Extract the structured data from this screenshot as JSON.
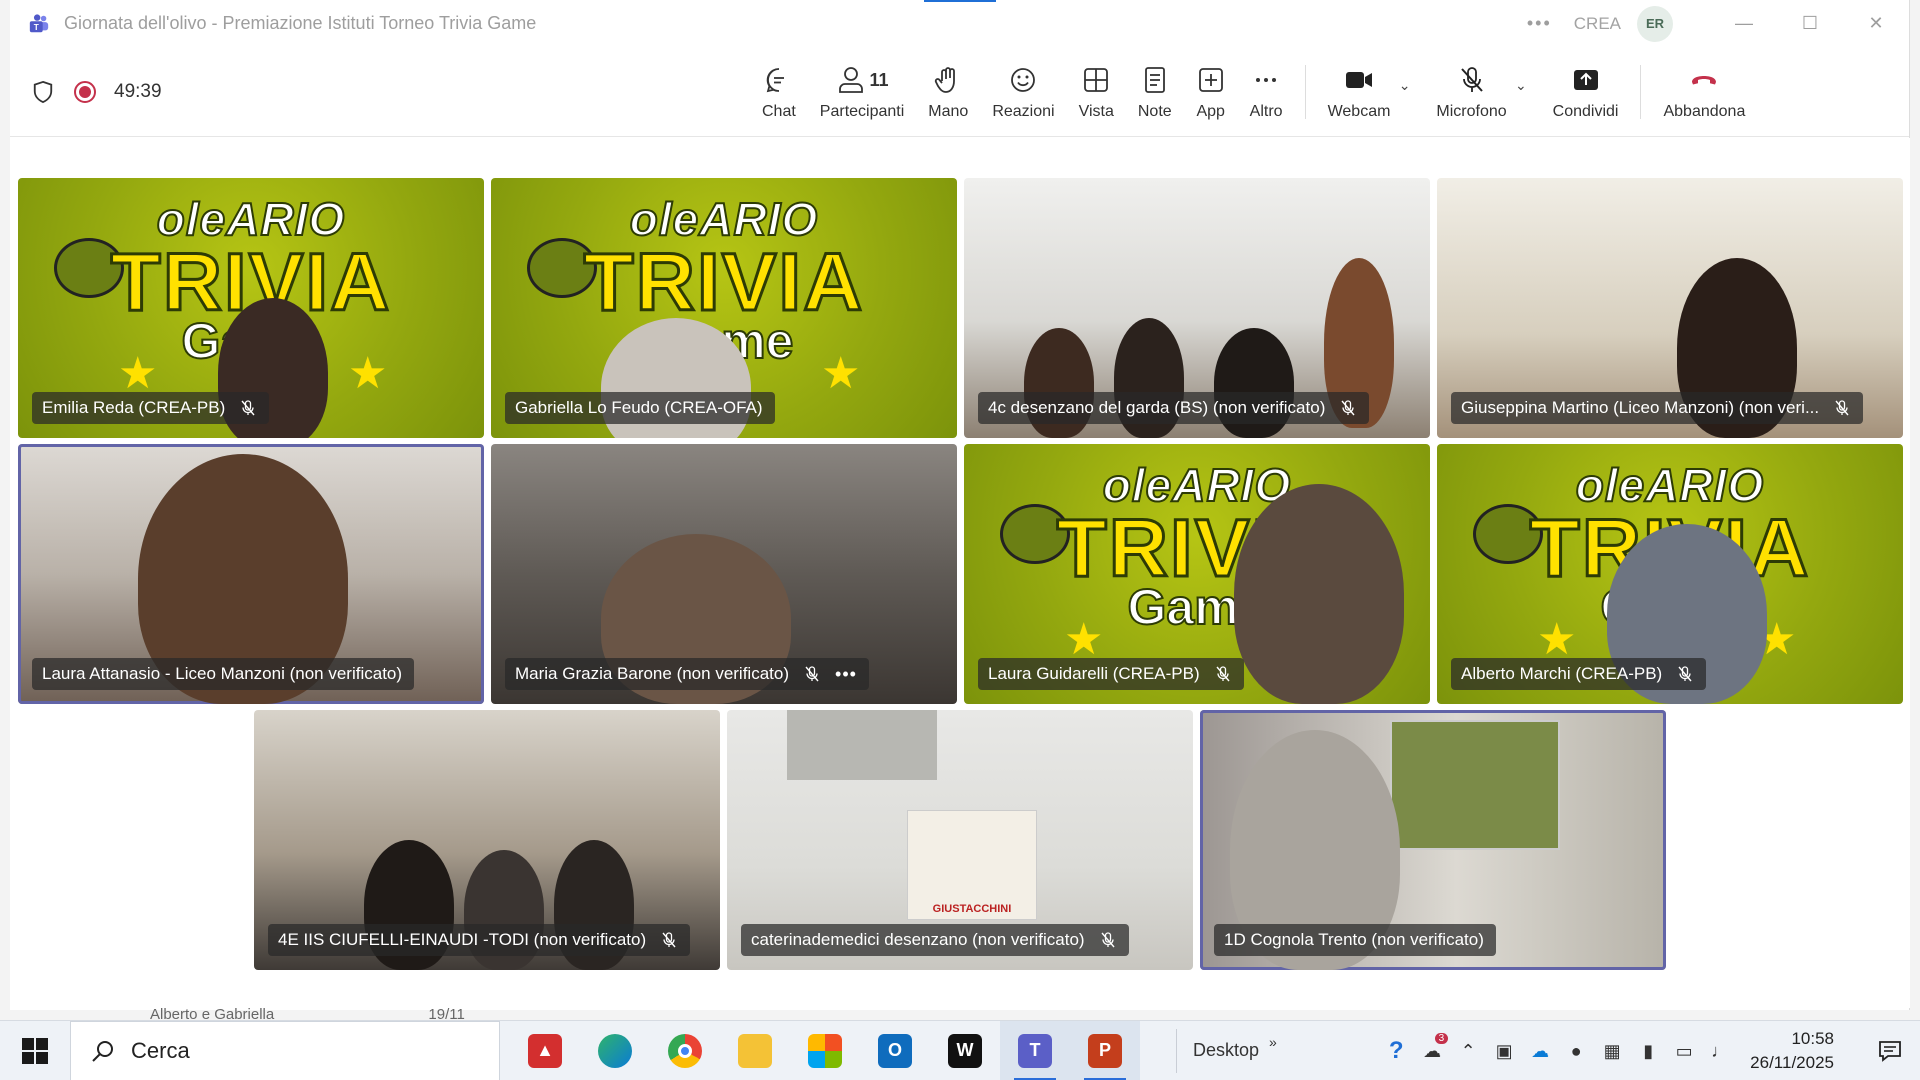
{
  "window": {
    "title": "Giornata dell'olivo - Premiazione Istituti Torneo Trivia Game",
    "org": "CREA",
    "avatar_initials": "ER"
  },
  "meeting": {
    "timer": "49:39",
    "participants_count": "11"
  },
  "toolbar": {
    "chat": "Chat",
    "participants": "Partecipanti",
    "hand": "Mano",
    "reactions": "Reazioni",
    "view": "Vista",
    "notes": "Note",
    "apps": "App",
    "more": "Altro",
    "webcam": "Webcam",
    "mic": "Microfono",
    "share": "Condividi",
    "leave": "Abbandona"
  },
  "tiles": [
    {
      "name": "Emilia Reda (CREA-PB)",
      "muted": true
    },
    {
      "name": "Gabriella Lo Feudo (CREA-OFA)",
      "muted": false
    },
    {
      "name": "4c desenzano del garda (BS) (non verificato)",
      "muted": true
    },
    {
      "name": "Giuseppina Martino (Liceo Manzoni) (non veri...",
      "muted": true
    },
    {
      "name": "Laura Attanasio - Liceo Manzoni (non verificato)",
      "muted": false
    },
    {
      "name": "Maria Grazia Barone (non verificato)",
      "muted": true
    },
    {
      "name": "Laura Guidarelli (CREA-PB)",
      "muted": true
    },
    {
      "name": "Alberto Marchi (CREA-PB)",
      "muted": true
    },
    {
      "name": "4E IIS CIUFELLI-EINAUDI -TODI (non verificato)",
      "muted": true
    },
    {
      "name": "caterinademedici desenzano (non verificato)",
      "muted": true
    },
    {
      "name": "1D Cognola Trento (non verificato)",
      "muted": false
    }
  ],
  "background_text": {
    "line1": "oleARIO",
    "line2": "TRIVIA",
    "line3": "Game",
    "poster": "GIUSTACCHINI"
  },
  "peek_text": {
    "name": "Alberto e Gabriella",
    "date": "19/11"
  },
  "taskbar": {
    "search_label": "Cerca",
    "desktop_label": "Desktop",
    "time": "10:58",
    "date": "26/11/2025",
    "badge": "3"
  },
  "colors": {
    "accent": "#6264a7",
    "record": "#c4314b",
    "leave": "#c4314b"
  }
}
